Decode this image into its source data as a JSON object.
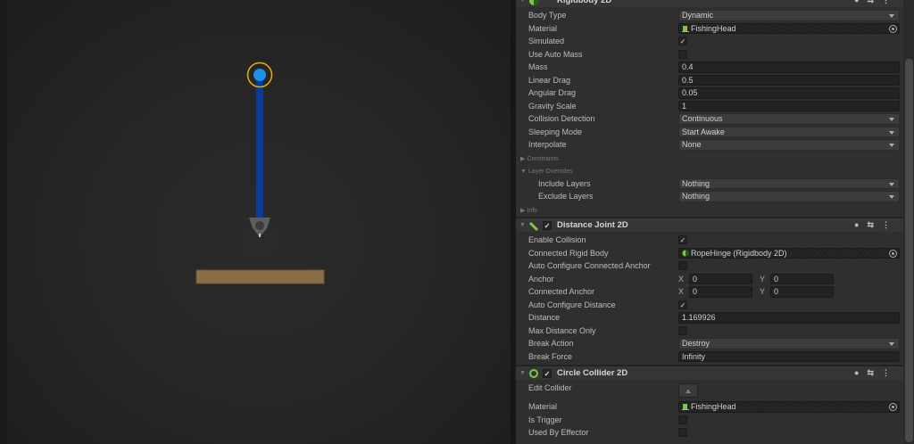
{
  "scene": {
    "colors": {
      "rope": "#0a3a9a",
      "hinge": "#1893e6",
      "ring": "#e8b100",
      "platform": "#8b6f44"
    }
  },
  "inspector": {
    "sections": [
      {
        "title": "Rigidbody 2D",
        "icon": "rigidbody-icon",
        "enabled": null,
        "rows": [
          {
            "type": "dropdown",
            "label": "Body Type",
            "value": "Dynamic"
          },
          {
            "type": "object",
            "label": "Material",
            "value": "FishingHead"
          },
          {
            "type": "check",
            "label": "Simulated",
            "checked": true
          },
          {
            "type": "check",
            "label": "Use Auto Mass",
            "checked": false
          },
          {
            "type": "text",
            "label": "Mass",
            "value": "0.4"
          },
          {
            "type": "text",
            "label": "Linear Drag",
            "value": "0.5"
          },
          {
            "type": "text",
            "label": "Angular Drag",
            "value": "0.05"
          },
          {
            "type": "text",
            "label": "Gravity Scale",
            "value": "1"
          },
          {
            "type": "dropdown",
            "label": "Collision Detection",
            "value": "Continuous"
          },
          {
            "type": "dropdown",
            "label": "Sleeping Mode",
            "value": "Start Awake"
          },
          {
            "type": "dropdown",
            "label": "Interpolate",
            "value": "None"
          },
          {
            "type": "foldout",
            "label": "Constraints",
            "open": false
          },
          {
            "type": "foldout",
            "label": "Layer Overrides",
            "open": true
          },
          {
            "type": "dropdown",
            "label": "Include Layers",
            "value": "Nothing",
            "indent": true
          },
          {
            "type": "dropdown",
            "label": "Exclude Layers",
            "value": "Nothing",
            "indent": true
          },
          {
            "type": "foldout",
            "label": "Info",
            "open": false
          }
        ]
      },
      {
        "title": "Distance Joint 2D",
        "icon": "distance-joint-icon",
        "enabled": true,
        "rows": [
          {
            "type": "check",
            "label": "Enable Collision",
            "checked": true
          },
          {
            "type": "object",
            "label": "Connected Rigid Body",
            "value": "RopeHinge (Rigidbody 2D)",
            "objicon": "rigidbody"
          },
          {
            "type": "check",
            "label": "Auto Configure Connected Anchor",
            "checked": false
          },
          {
            "type": "vec2",
            "label": "Anchor",
            "x": "0",
            "y": "0"
          },
          {
            "type": "vec2",
            "label": "Connected Anchor",
            "x": "0",
            "y": "0"
          },
          {
            "type": "check",
            "label": "Auto Configure Distance",
            "checked": true
          },
          {
            "type": "text",
            "label": "Distance",
            "value": "1.169926"
          },
          {
            "type": "check",
            "label": "Max Distance Only",
            "checked": false
          },
          {
            "type": "dropdown",
            "label": "Break Action",
            "value": "Destroy"
          },
          {
            "type": "text",
            "label": "Break Force",
            "value": "Infinity"
          }
        ]
      },
      {
        "title": "Circle Collider 2D",
        "icon": "circle-collider-icon",
        "enabled": true,
        "rows": [
          {
            "type": "button",
            "label": "Edit Collider"
          },
          {
            "type": "object",
            "label": "Material",
            "value": "FishingHead"
          },
          {
            "type": "check",
            "label": "Is Trigger",
            "checked": false
          },
          {
            "type": "check",
            "label": "Used By Effector",
            "checked": false
          }
        ]
      }
    ]
  }
}
